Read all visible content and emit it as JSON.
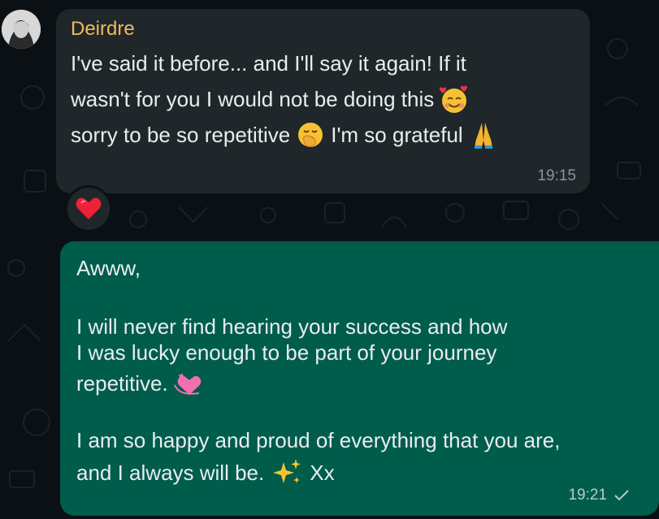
{
  "incoming": {
    "sender": "Deirdre",
    "line1": "I've said it before... and I'll say it again! If it",
    "line2": "wasn't for you I would not be doing this",
    "line3a": "sorry to be so repetitive",
    "line3b": "I'm so grateful",
    "time": "19:15",
    "reaction_icon": "red-heart-icon"
  },
  "outgoing": {
    "p1": "Awww,",
    "p2_l1": "I will never find hearing your success and how",
    "p2_l2": "I was lucky enough to be part of your journey",
    "p2_l3": "repetitive.",
    "p3_l1": "I am so happy and proud of everything that you are,",
    "p3_l2": "and I always will be.",
    "p3_l2_end": "Xx",
    "time": "19:21",
    "status_icon": "single-check-icon"
  },
  "colors": {
    "incoming_bubble": "#1f272a",
    "outgoing_bubble": "#005c4b",
    "sender_name": "#f1b95b",
    "background": "#0b1014"
  }
}
